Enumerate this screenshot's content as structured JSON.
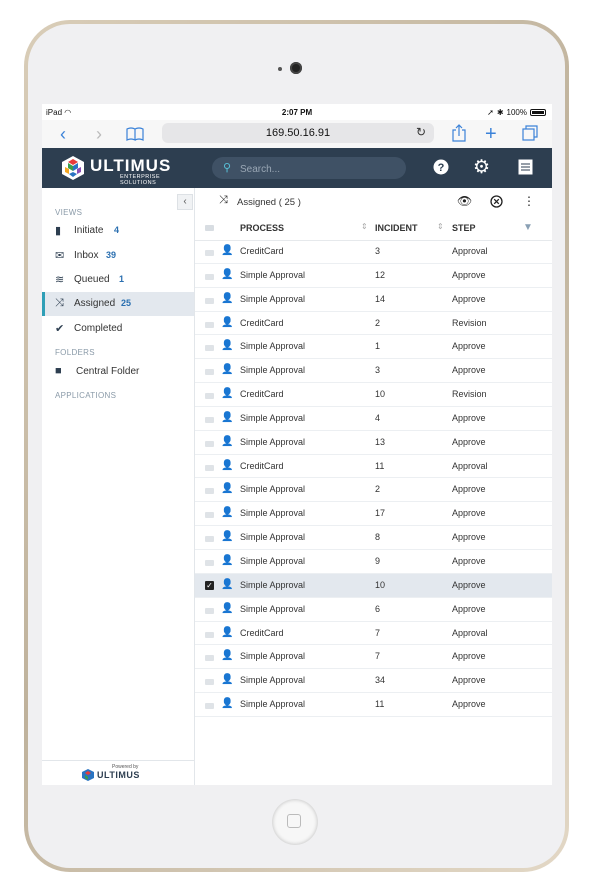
{
  "status_bar": {
    "device": "iPad",
    "time": "2:07 PM",
    "battery": "100%"
  },
  "browser": {
    "url": "169.50.16.91"
  },
  "app": {
    "logo_text": "ULTIMUS",
    "logo_subtitle": "ENTERPRISE SOLUTIONS",
    "search_placeholder": "Search..."
  },
  "sidebar": {
    "views_label": "VIEWS",
    "views": [
      {
        "label": "Initiate",
        "count": "4",
        "icon": "phone-icon"
      },
      {
        "label": "Inbox",
        "count": "39",
        "icon": "inbox-icon"
      },
      {
        "label": "Queued",
        "count": "1",
        "icon": "stack-icon"
      },
      {
        "label": "Assigned",
        "count": "25",
        "icon": "shuffle-icon",
        "active": true
      },
      {
        "label": "Completed",
        "count": "",
        "icon": "check-circle-icon"
      }
    ],
    "folders_label": "FOLDERS",
    "folders": [
      {
        "label": "Central Folder",
        "icon": "folder-lock-icon"
      }
    ],
    "applications_label": "APPLICATIONS",
    "powered_by": "Powered by",
    "powered_logo": "ULTIMUS"
  },
  "list": {
    "title": "Assigned ( 25 )",
    "columns": {
      "process": "PROCESS",
      "incident": "INCIDENT",
      "step": "STEP"
    },
    "rows": [
      {
        "process": "CreditCard",
        "incident": "3",
        "step": "Approval"
      },
      {
        "process": "Simple Approval",
        "incident": "12",
        "step": "Approve"
      },
      {
        "process": "Simple Approval",
        "incident": "14",
        "step": "Approve"
      },
      {
        "process": "CreditCard",
        "incident": "2",
        "step": "Revision"
      },
      {
        "process": "Simple Approval",
        "incident": "1",
        "step": "Approve"
      },
      {
        "process": "Simple Approval",
        "incident": "3",
        "step": "Approve"
      },
      {
        "process": "CreditCard",
        "incident": "10",
        "step": "Revision"
      },
      {
        "process": "Simple Approval",
        "incident": "4",
        "step": "Approve"
      },
      {
        "process": "Simple Approval",
        "incident": "13",
        "step": "Approve"
      },
      {
        "process": "CreditCard",
        "incident": "11",
        "step": "Approval"
      },
      {
        "process": "Simple Approval",
        "incident": "2",
        "step": "Approve"
      },
      {
        "process": "Simple Approval",
        "incident": "17",
        "step": "Approve"
      },
      {
        "process": "Simple Approval",
        "incident": "8",
        "step": "Approve"
      },
      {
        "process": "Simple Approval",
        "incident": "9",
        "step": "Approve"
      },
      {
        "process": "Simple Approval",
        "incident": "10",
        "step": "Approve",
        "checked": true
      },
      {
        "process": "Simple Approval",
        "incident": "6",
        "step": "Approve"
      },
      {
        "process": "CreditCard",
        "incident": "7",
        "step": "Approval"
      },
      {
        "process": "Simple Approval",
        "incident": "7",
        "step": "Approve"
      },
      {
        "process": "Simple Approval",
        "incident": "34",
        "step": "Approve"
      },
      {
        "process": "Simple Approval",
        "incident": "11",
        "step": "Approve"
      }
    ]
  },
  "colors": {
    "header": "#2d3e50",
    "accent": "#2f9fb7",
    "count": "#2a6fb0",
    "selected_row": "#e3e8ee"
  }
}
